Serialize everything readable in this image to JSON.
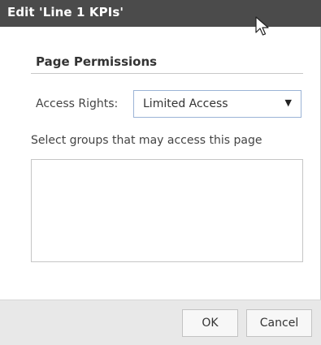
{
  "dialog": {
    "title": "Edit 'Line 1 KPIs'"
  },
  "permissions": {
    "section_title": "Page Permissions",
    "access_rights_label": "Access Rights:",
    "access_rights_value": "Limited Access",
    "groups_label": "Select groups that may access this page",
    "groups": []
  },
  "buttons": {
    "ok": "OK",
    "cancel": "Cancel"
  },
  "icons": {
    "dropdown": "caret-down-icon",
    "cursor": "mouse-pointer-icon"
  },
  "colors": {
    "titlebar": "#4b4b4b",
    "footer": "#e8e8e8",
    "select_border": "#9bb3d6"
  }
}
